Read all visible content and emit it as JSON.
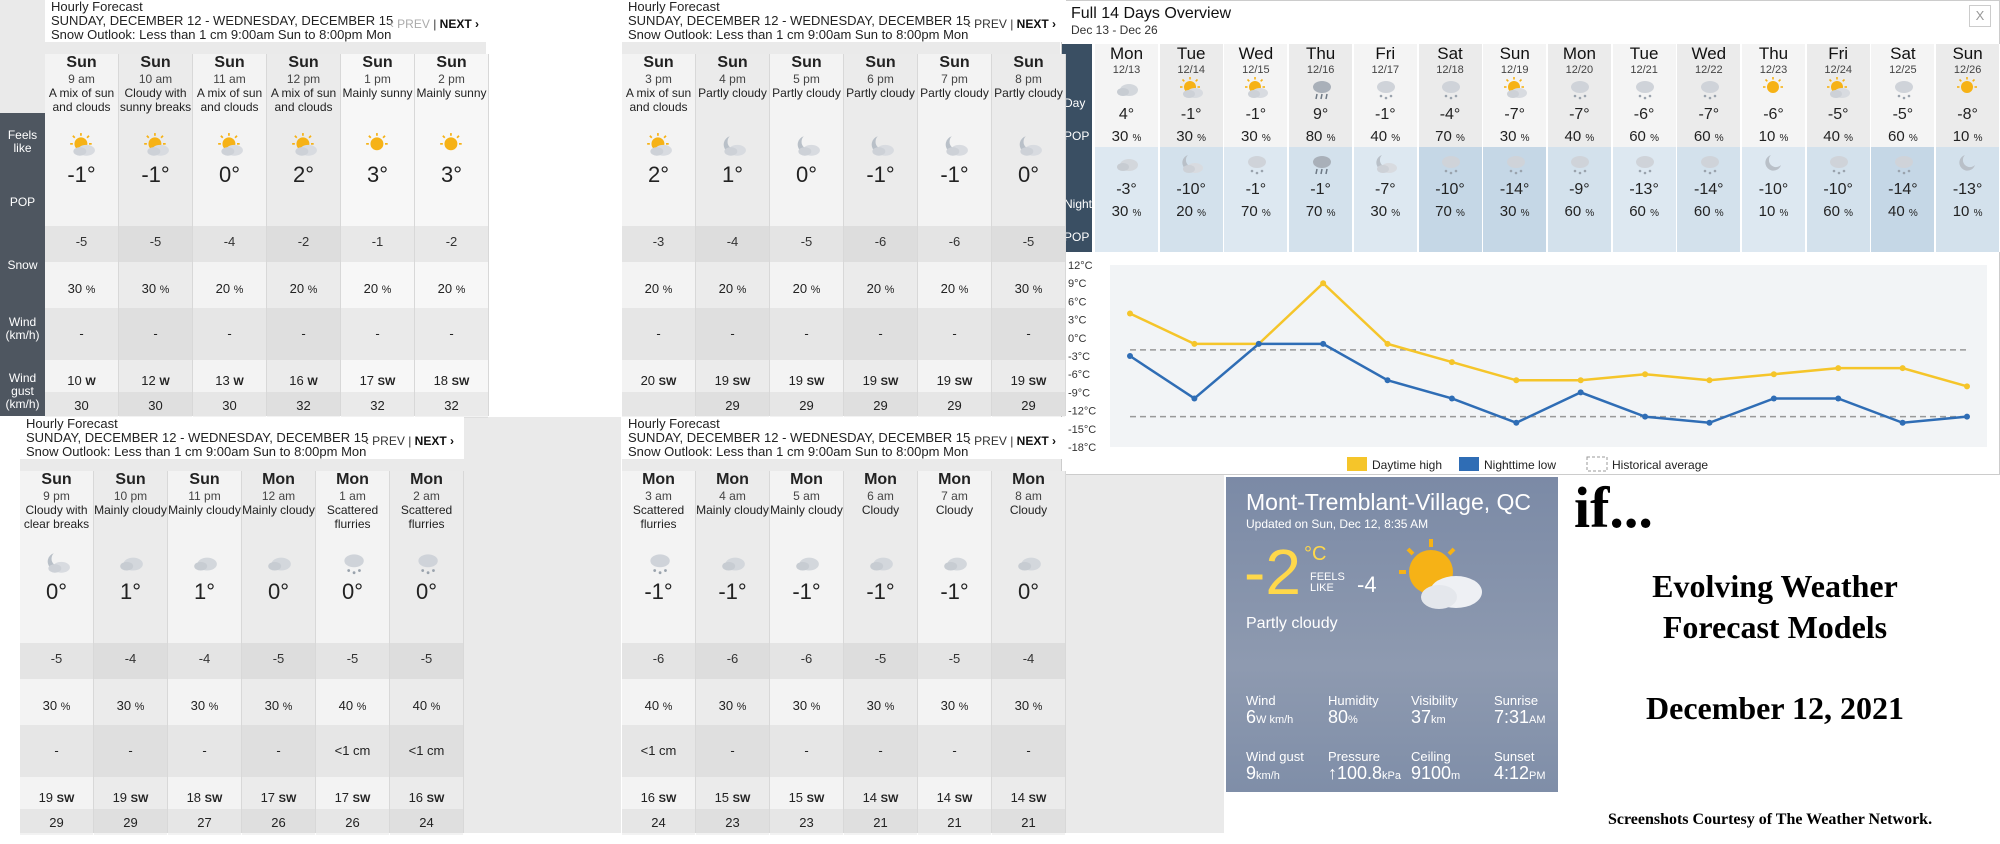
{
  "hourly_panels": [
    {
      "title": "Hourly Forecast",
      "range": "SUNDAY, DECEMBER 12 - WEDNESDAY, DECEMBER 15",
      "outlook": "Snow Outlook: Less than 1 cm 9:00am Sun to 8:00pm Mon",
      "prev": "‹ PREV",
      "next": "NEXT ›",
      "sidebar": [
        "Feels like",
        "POP",
        "Snow",
        "Wind (km/h)",
        "Wind gust (km/h)"
      ],
      "cols": [
        {
          "day": "Sun",
          "time": "9 am",
          "cond": "A mix of sun and clouds",
          "icon": "sun-cloud-icon",
          "temp": "-1°",
          "feels": "-5",
          "pop": "30",
          "snow": "-",
          "wind": "10",
          "dir": "W",
          "gust": "30"
        },
        {
          "day": "Sun",
          "time": "10 am",
          "cond": "Cloudy with sunny breaks",
          "icon": "sun-cloud-icon",
          "temp": "-1°",
          "feels": "-5",
          "pop": "30",
          "snow": "-",
          "wind": "12",
          "dir": "W",
          "gust": "30"
        },
        {
          "day": "Sun",
          "time": "11 am",
          "cond": "A mix of sun and clouds",
          "icon": "sun-cloud-icon",
          "temp": "0°",
          "feels": "-4",
          "pop": "20",
          "snow": "-",
          "wind": "13",
          "dir": "W",
          "gust": "30"
        },
        {
          "day": "Sun",
          "time": "12 pm",
          "cond": "A mix of sun and clouds",
          "icon": "sun-cloud-icon",
          "temp": "2°",
          "feels": "-2",
          "pop": "20",
          "snow": "-",
          "wind": "16",
          "dir": "W",
          "gust": "32"
        },
        {
          "day": "Sun",
          "time": "1 pm",
          "cond": "Mainly sunny",
          "icon": "sun-icon",
          "temp": "3°",
          "feels": "-1",
          "pop": "20",
          "snow": "-",
          "wind": "17",
          "dir": "SW",
          "gust": "32"
        },
        {
          "day": "Sun",
          "time": "2 pm",
          "cond": "Mainly sunny",
          "icon": "sun-icon",
          "temp": "3°",
          "feels": "-2",
          "pop": "20",
          "snow": "-",
          "wind": "18",
          "dir": "SW",
          "gust": "32"
        }
      ]
    },
    {
      "title": "Hourly Forecast",
      "range": "SUNDAY, DECEMBER 12 - WEDNESDAY, DECEMBER 15",
      "outlook": "Snow Outlook: Less than 1 cm 9:00am Sun to 8:00pm Mon",
      "prev": "‹ PREV",
      "next": "NEXT ›",
      "cols": [
        {
          "day": "Sun",
          "time": "3 pm",
          "cond": "A mix of sun and clouds",
          "icon": "sun-cloud-icon",
          "temp": "2°",
          "feels": "-3",
          "pop": "20",
          "snow": "-",
          "wind": "20",
          "dir": "SW",
          "gust": ""
        },
        {
          "day": "Sun",
          "time": "4 pm",
          "cond": "Partly cloudy",
          "icon": "moon-cloud-icon",
          "temp": "1°",
          "feels": "-4",
          "pop": "20",
          "snow": "-",
          "wind": "19",
          "dir": "SW",
          "gust": "29"
        },
        {
          "day": "Sun",
          "time": "5 pm",
          "cond": "Partly cloudy",
          "icon": "moon-cloud-icon",
          "temp": "0°",
          "feels": "-5",
          "pop": "20",
          "snow": "-",
          "wind": "19",
          "dir": "SW",
          "gust": "29"
        },
        {
          "day": "Sun",
          "time": "6 pm",
          "cond": "Partly cloudy",
          "icon": "moon-cloud-icon",
          "temp": "-1°",
          "feels": "-6",
          "pop": "20",
          "snow": "-",
          "wind": "19",
          "dir": "SW",
          "gust": "29"
        },
        {
          "day": "Sun",
          "time": "7 pm",
          "cond": "Partly cloudy",
          "icon": "moon-cloud-icon",
          "temp": "-1°",
          "feels": "-6",
          "pop": "20",
          "snow": "-",
          "wind": "19",
          "dir": "SW",
          "gust": "29"
        },
        {
          "day": "Sun",
          "time": "8 pm",
          "cond": "Partly cloudy",
          "icon": "moon-cloud-icon",
          "temp": "0°",
          "feels": "-5",
          "pop": "30",
          "snow": "-",
          "wind": "19",
          "dir": "SW",
          "gust": "29"
        }
      ]
    },
    {
      "title": "Hourly Forecast",
      "range": "SUNDAY, DECEMBER 12 - WEDNESDAY, DECEMBER 15",
      "outlook": "Snow Outlook: Less than 1 cm 9:00am Sun to 8:00pm Mon",
      "prev": "‹ PREV",
      "next": "NEXT ›",
      "cols": [
        {
          "day": "Sun",
          "time": "9 pm",
          "cond": "Cloudy with clear breaks",
          "icon": "moon-cloud-icon",
          "temp": "0°",
          "feels": "-5",
          "pop": "30",
          "snow": "-",
          "wind": "19",
          "dir": "SW",
          "gust": "29"
        },
        {
          "day": "Sun",
          "time": "10 pm",
          "cond": "Mainly cloudy",
          "icon": "cloud-icon",
          "temp": "1°",
          "feels": "-4",
          "pop": "30",
          "snow": "-",
          "wind": "19",
          "dir": "SW",
          "gust": "29"
        },
        {
          "day": "Sun",
          "time": "11 pm",
          "cond": "Mainly cloudy",
          "icon": "cloud-icon",
          "temp": "1°",
          "feels": "-4",
          "pop": "30",
          "snow": "-",
          "wind": "18",
          "dir": "SW",
          "gust": "27"
        },
        {
          "day": "Mon",
          "time": "12 am",
          "cond": "Mainly cloudy",
          "icon": "cloud-icon",
          "temp": "0°",
          "feels": "-5",
          "pop": "30",
          "snow": "-",
          "wind": "17",
          "dir": "SW",
          "gust": "26"
        },
        {
          "day": "Mon",
          "time": "1 am",
          "cond": "Scattered flurries",
          "icon": "snow-cloud-icon",
          "temp": "0°",
          "feels": "-5",
          "pop": "40",
          "snow": "<1 cm",
          "wind": "17",
          "dir": "SW",
          "gust": "26"
        },
        {
          "day": "Mon",
          "time": "2 am",
          "cond": "Scattered flurries",
          "icon": "snow-cloud-icon",
          "temp": "0°",
          "feels": "-5",
          "pop": "40",
          "snow": "<1 cm",
          "wind": "16",
          "dir": "SW",
          "gust": "24"
        }
      ]
    },
    {
      "title": "Hourly Forecast",
      "range": "SUNDAY, DECEMBER 12 - WEDNESDAY, DECEMBER 15",
      "outlook": "Snow Outlook: Less than 1 cm 9:00am Sun to 8:00pm Mon",
      "prev": "‹ PREV",
      "next": "NEXT ›",
      "cols": [
        {
          "day": "Mon",
          "time": "3 am",
          "cond": "Scattered flurries",
          "icon": "snow-cloud-icon",
          "temp": "-1°",
          "feels": "-6",
          "pop": "40",
          "snow": "<1 cm",
          "wind": "16",
          "dir": "SW",
          "gust": "24"
        },
        {
          "day": "Mon",
          "time": "4 am",
          "cond": "Mainly cloudy",
          "icon": "cloud-icon",
          "temp": "-1°",
          "feels": "-6",
          "pop": "30",
          "snow": "-",
          "wind": "15",
          "dir": "SW",
          "gust": "23"
        },
        {
          "day": "Mon",
          "time": "5 am",
          "cond": "Mainly cloudy",
          "icon": "cloud-icon",
          "temp": "-1°",
          "feels": "-6",
          "pop": "30",
          "snow": "-",
          "wind": "15",
          "dir": "SW",
          "gust": "23"
        },
        {
          "day": "Mon",
          "time": "6 am",
          "cond": "Cloudy",
          "icon": "cloud-icon",
          "temp": "-1°",
          "feels": "-5",
          "pop": "30",
          "snow": "-",
          "wind": "14",
          "dir": "SW",
          "gust": "21"
        },
        {
          "day": "Mon",
          "time": "7 am",
          "cond": "Cloudy",
          "icon": "cloud-icon",
          "temp": "-1°",
          "feels": "-5",
          "pop": "30",
          "snow": "-",
          "wind": "14",
          "dir": "SW",
          "gust": "21"
        },
        {
          "day": "Mon",
          "time": "8 am",
          "cond": "Cloudy",
          "icon": "cloud-icon",
          "temp": "0°",
          "feels": "-4",
          "pop": "30",
          "snow": "-",
          "wind": "14",
          "dir": "SW",
          "gust": "21"
        }
      ]
    }
  ],
  "overview": {
    "title": "Full 14 Days Overview",
    "range": "Dec 13 - Dec 26",
    "close": "X",
    "side": {
      "day": "Day",
      "pop": "POP",
      "night": "Night",
      "pop2": "POP"
    },
    "days": [
      {
        "d": "Mon",
        "date": "12/13",
        "hi": "4°",
        "dpop": "30",
        "lo": "-3°",
        "npop": "30",
        "di": "cloud-icon",
        "ni": "cloud-icon"
      },
      {
        "d": "Tue",
        "date": "12/14",
        "hi": "-1°",
        "dpop": "30",
        "lo": "-10°",
        "npop": "20",
        "di": "sun-cloud-icon",
        "ni": "moon-cloud-icon"
      },
      {
        "d": "Wed",
        "date": "12/15",
        "hi": "-1°",
        "dpop": "30",
        "lo": "-1°",
        "npop": "70",
        "di": "sun-cloud-icon",
        "ni": "snow-cloud-icon"
      },
      {
        "d": "Thu",
        "date": "12/16",
        "hi": "9°",
        "dpop": "80",
        "lo": "-1°",
        "npop": "70",
        "di": "rain-cloud-icon",
        "ni": "rain-cloud-icon"
      },
      {
        "d": "Fri",
        "date": "12/17",
        "hi": "-1°",
        "dpop": "40",
        "lo": "-7°",
        "npop": "30",
        "di": "snow-cloud-icon",
        "ni": "moon-cloud-icon"
      },
      {
        "d": "Sat",
        "date": "12/18",
        "hi": "-4°",
        "dpop": "70",
        "lo": "-10°",
        "npop": "70",
        "di": "snow-cloud-icon",
        "ni": "snow-cloud-icon"
      },
      {
        "d": "Sun",
        "date": "12/19",
        "hi": "-7°",
        "dpop": "30",
        "lo": "-14°",
        "npop": "30",
        "di": "sun-cloud-icon",
        "ni": "snow-cloud-icon"
      },
      {
        "d": "Mon",
        "date": "12/20",
        "hi": "-7°",
        "dpop": "40",
        "lo": "-9°",
        "npop": "60",
        "di": "snow-cloud-icon",
        "ni": "snow-cloud-icon"
      },
      {
        "d": "Tue",
        "date": "12/21",
        "hi": "-6°",
        "dpop": "60",
        "lo": "-13°",
        "npop": "60",
        "di": "snow-cloud-icon",
        "ni": "snow-cloud-icon"
      },
      {
        "d": "Wed",
        "date": "12/22",
        "hi": "-7°",
        "dpop": "60",
        "lo": "-14°",
        "npop": "60",
        "di": "snow-cloud-icon",
        "ni": "snow-cloud-icon"
      },
      {
        "d": "Thu",
        "date": "12/23",
        "hi": "-6°",
        "dpop": "10",
        "lo": "-10°",
        "npop": "10",
        "di": "sun-icon",
        "ni": "moon-icon"
      },
      {
        "d": "Fri",
        "date": "12/24",
        "hi": "-5°",
        "dpop": "40",
        "lo": "-10°",
        "npop": "60",
        "di": "sun-cloud-icon",
        "ni": "snow-cloud-icon"
      },
      {
        "d": "Sat",
        "date": "12/25",
        "hi": "-5°",
        "dpop": "60",
        "lo": "-14°",
        "npop": "40",
        "di": "snow-cloud-icon",
        "ni": "snow-cloud-icon"
      },
      {
        "d": "Sun",
        "date": "12/26",
        "hi": "-8°",
        "dpop": "10",
        "lo": "-13°",
        "npop": "10",
        "di": "sun-icon",
        "ni": "moon-icon"
      }
    ]
  },
  "chart_data": {
    "type": "line",
    "x": [
      "12/13",
      "12/14",
      "12/15",
      "12/16",
      "12/17",
      "12/18",
      "12/19",
      "12/20",
      "12/21",
      "12/22",
      "12/23",
      "12/24",
      "12/25",
      "12/26"
    ],
    "series": [
      {
        "name": "Daytime high",
        "values": [
          4,
          -1,
          -1,
          9,
          -1,
          -4,
          -7,
          -7,
          -6,
          -7,
          -6,
          -5,
          -5,
          -8
        ],
        "color": "#f5c52a"
      },
      {
        "name": "Nighttime low",
        "values": [
          -3,
          -10,
          -1,
          -1,
          -7,
          -10,
          -14,
          -9,
          -13,
          -14,
          -10,
          -10,
          -14,
          -13
        ],
        "color": "#2f6db5"
      },
      {
        "name": "Historical average",
        "values": [
          -2,
          -2,
          -2,
          -2,
          -2,
          -2,
          -2,
          -2,
          -2,
          -2,
          -2,
          -2,
          -2,
          -2
        ],
        "values_low": [
          -13,
          -13,
          -13,
          -13,
          -13,
          -13,
          -13,
          -13,
          -13,
          -13,
          -13,
          -13,
          -13,
          -13
        ],
        "color": "#999999"
      }
    ],
    "yticks": [
      "12°C",
      "9°C",
      "6°C",
      "3°C",
      "0°C",
      "-3°C",
      "-6°C",
      "-9°C",
      "-12°C",
      "-15°C",
      "-18°C"
    ],
    "ylim": [
      -18,
      12
    ],
    "legend": "bottom"
  },
  "current": {
    "city": "Mont-Tremblant-Village, QC",
    "updated": "Updated on Sun, Dec 12, 8:35 AM",
    "temp": "-2",
    "unit": "°C",
    "feels_label": "FEELS LIKE",
    "feels": "-4",
    "cond": "Partly cloudy",
    "stats": [
      {
        "label": "Wind",
        "value": "6",
        "unit": "W km/h"
      },
      {
        "label": "Humidity",
        "value": "80",
        "unit": "%"
      },
      {
        "label": "Visibility",
        "value": "37",
        "unit": "km"
      },
      {
        "label": "Sunrise",
        "value": "7:31",
        "unit": "AM"
      },
      {
        "label": "Wind gust",
        "value": "9",
        "unit": "km/h"
      },
      {
        "label": "Pressure",
        "value": "↑100.8",
        "unit": "kPa"
      },
      {
        "label": "Ceiling",
        "value": "9100",
        "unit": "m"
      },
      {
        "label": "Sunset",
        "value": "4:12",
        "unit": "PM"
      }
    ]
  },
  "caption": {
    "if": "if...",
    "line1": "Evolving Weather",
    "line2": "Forecast Models",
    "date": "December 12, 2021",
    "credit": "Screenshots Courtesy of The Weather Network."
  }
}
